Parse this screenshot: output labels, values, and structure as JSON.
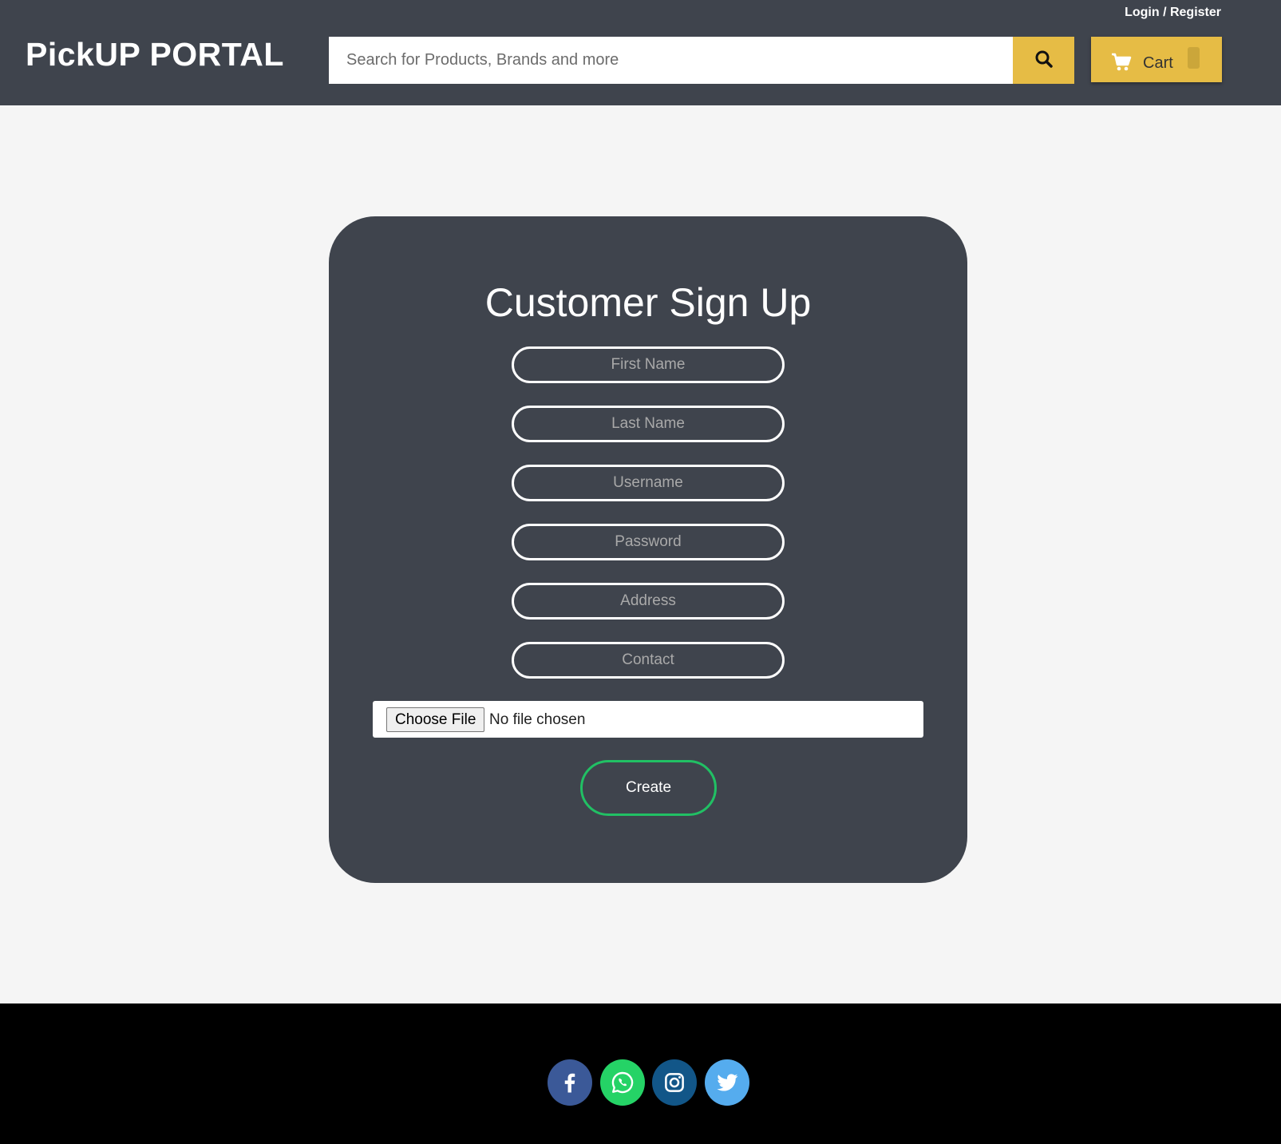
{
  "header": {
    "logo": "PickUP PORTAL",
    "login_register": "Login / Register",
    "search": {
      "placeholder": "Search for Products, Brands and more",
      "button_icon": "search-icon"
    },
    "cart": {
      "label": "Cart",
      "icon": "cart-icon"
    }
  },
  "signup": {
    "title": "Customer Sign Up",
    "fields": {
      "first_name": "First Name",
      "last_name": "Last Name",
      "username": "Username",
      "password": "Password",
      "address": "Address",
      "contact": "Contact"
    },
    "file_input": {
      "button": "Choose File",
      "status": "No file chosen"
    },
    "create_button": "Create"
  },
  "footer": {
    "social": [
      {
        "name": "facebook-icon",
        "color": "#3b5998"
      },
      {
        "name": "whatsapp-icon",
        "color": "#25d366"
      },
      {
        "name": "instagram-icon",
        "color": "#125688"
      },
      {
        "name": "twitter-icon",
        "color": "#55acee"
      }
    ]
  },
  "colors": {
    "header_bg": "#3f444d",
    "accent_yellow": "#e6bc45",
    "create_border": "#21c064",
    "page_bg": "#f5f5f5",
    "footer_bg": "#000000"
  }
}
